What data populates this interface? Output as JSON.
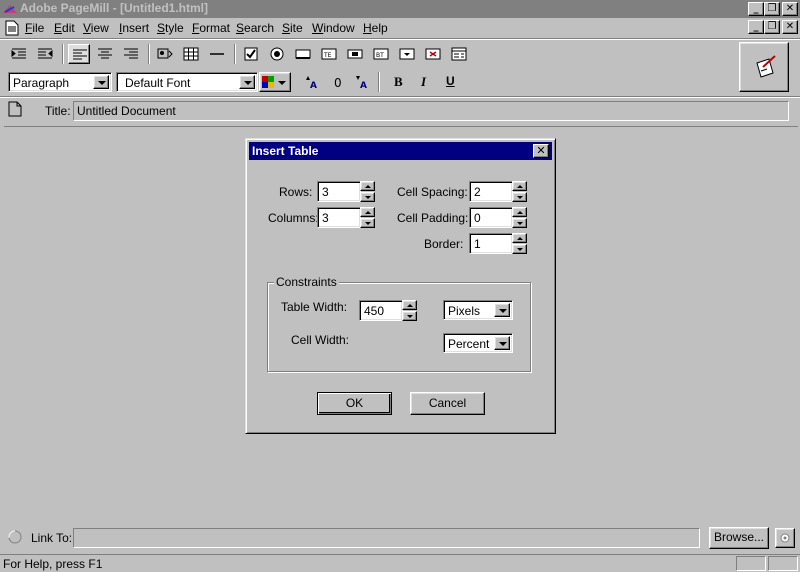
{
  "window": {
    "title": "Adobe PageMill - [Untitled1.html]"
  },
  "menu": [
    "File",
    "Edit",
    "View",
    "Insert",
    "Style",
    "Format",
    "Search",
    "Site",
    "Window",
    "Help"
  ],
  "format_bar": {
    "paragraph_style": "Paragraph",
    "font": "Default Font",
    "bold": "B",
    "italic": "I",
    "underline": "U"
  },
  "title_bar": {
    "label": "Title:",
    "value": "Untitled Document"
  },
  "dialog": {
    "title": "Insert Table",
    "rows_label": "Rows:",
    "rows_value": "3",
    "columns_label": "Columns:",
    "columns_value": "3",
    "cell_spacing_label": "Cell Spacing:",
    "cell_spacing_value": "2",
    "cell_padding_label": "Cell Padding:",
    "cell_padding_value": "0",
    "border_label": "Border:",
    "border_value": "1",
    "constraints_label": "Constraints",
    "table_width_label": "Table Width:",
    "table_width_value": "450",
    "table_width_unit": "Pixels",
    "cell_width_label": "Cell Width:",
    "cell_width_unit": "Percent",
    "ok_label": "OK",
    "cancel_label": "Cancel"
  },
  "link_bar": {
    "label": "Link To:",
    "value": "",
    "browse_label": "Browse..."
  },
  "status": {
    "text": "For Help, press F1"
  }
}
